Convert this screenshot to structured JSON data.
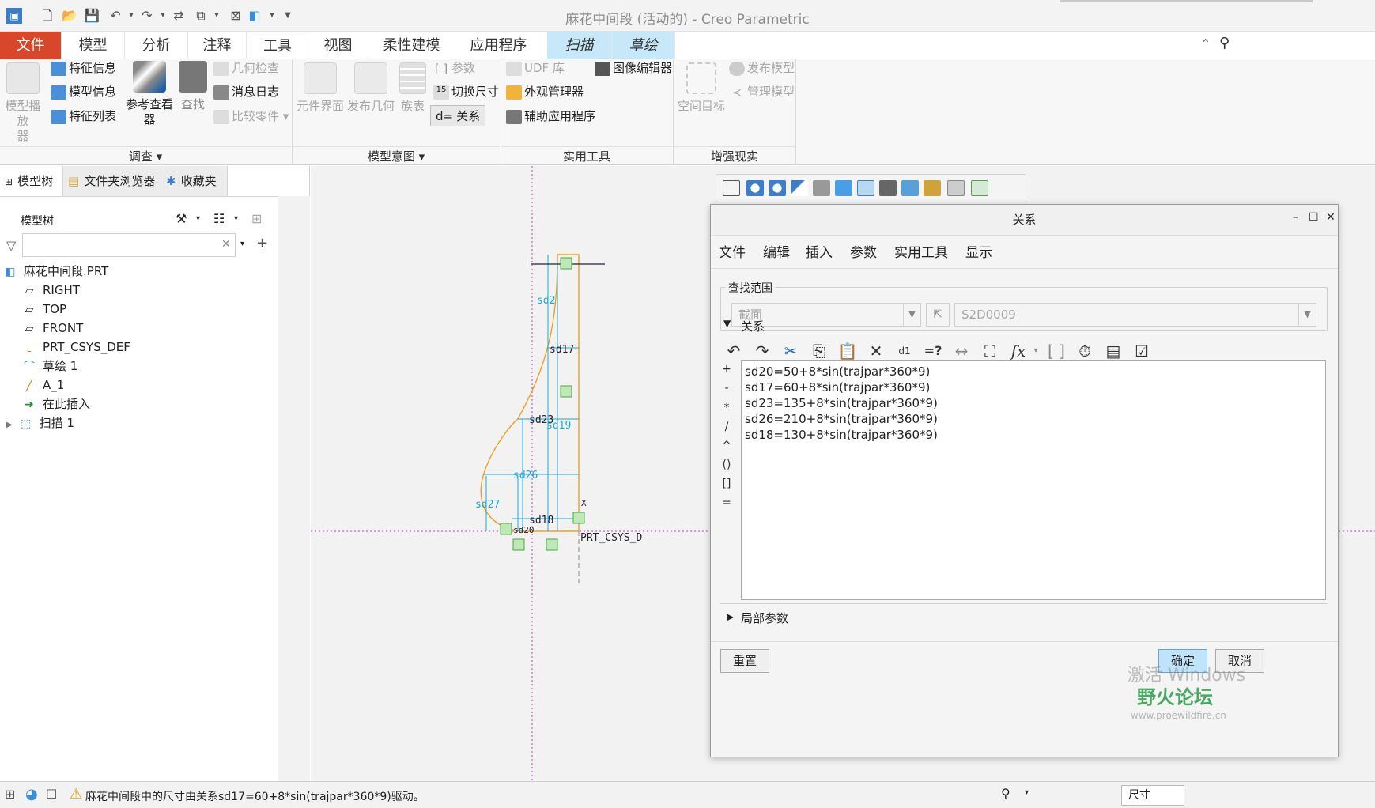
{
  "window": {
    "title": "麻花中间段 (活动的) - Creo Parametric"
  },
  "tabs": [
    {
      "label": "文件"
    },
    {
      "label": "模型"
    },
    {
      "label": "分析"
    },
    {
      "label": "注释"
    },
    {
      "label": "工具"
    },
    {
      "label": "视图"
    },
    {
      "label": "柔性建模"
    },
    {
      "label": "应用程序"
    },
    {
      "label": "扫描"
    },
    {
      "label": "草绘"
    }
  ],
  "ribbon": {
    "investigate": {
      "model_player": "模型播放\n器",
      "feature_info": "特征信息",
      "model_info": "模型信息",
      "feature_list": "特征列表",
      "ref_viewer": "参考查看\n器",
      "find": "查找",
      "geometry_check": "几何检查",
      "message_log": "消息日志",
      "compare_parts": "比较零件",
      "group_label": "调查"
    },
    "model_intent": {
      "component_interface": "元件界面",
      "publish_geometry": "发布几何",
      "family_table": "族表",
      "parameters": "参数",
      "switch_dims": "切换尺寸",
      "relations": "关系",
      "group_label": "模型意图"
    },
    "utilities": {
      "udf_library": "UDF 库",
      "image_editor": "图像编辑器",
      "appearance_manager": "外观管理器",
      "aux_apps": "辅助应用程序",
      "group_label": "实用工具"
    },
    "ar": {
      "space_target": "空间目标",
      "publish_model": "发布模型",
      "manage_model": "管理模型",
      "group_label": "增强现实"
    }
  },
  "left_panel": {
    "tabs": [
      "模型树",
      "文件夹浏览器",
      "收藏夹"
    ],
    "title": "模型树",
    "tree": [
      {
        "label": "麻花中间段.PRT",
        "icon": "part-icon"
      },
      {
        "label": "RIGHT",
        "icon": "datum-plane-icon"
      },
      {
        "label": "TOP",
        "icon": "datum-plane-icon"
      },
      {
        "label": "FRONT",
        "icon": "datum-plane-icon"
      },
      {
        "label": "PRT_CSYS_DEF",
        "icon": "csys-icon"
      },
      {
        "label": "草绘 1",
        "icon": "sketch-icon"
      },
      {
        "label": "A_1",
        "icon": "axis-icon"
      },
      {
        "label": "在此插入",
        "icon": "insert-here-icon"
      },
      {
        "label": "扫描 1",
        "icon": "sweep-icon"
      }
    ]
  },
  "sketch": {
    "dims": [
      "sd2",
      "sd17",
      "sd23",
      "sd19",
      "sd26",
      "sd27",
      "sd18",
      "sd20"
    ],
    "csys_label": "PRT_CSYS_D",
    "axis_x": "X"
  },
  "dialog": {
    "title": "关系",
    "menu": [
      "文件",
      "编辑",
      "插入",
      "参数",
      "实用工具",
      "显示"
    ],
    "scope_label": "查找范围",
    "scope_value": "截面",
    "scope_target": "S2D0009",
    "relations_label": "关系",
    "operators": [
      "+",
      "-",
      "*",
      "/",
      "^",
      "()",
      "[]",
      "="
    ],
    "lines": [
      "sd20=50+8*sin(trajpar*360*9)",
      "sd17=60+8*sin(trajpar*360*9)",
      "sd23=135+8*sin(trajpar*360*9)",
      "sd26=210+8*sin(trajpar*360*9)",
      "sd18=130+8*sin(trajpar*360*9)"
    ],
    "local_params_label": "局部参数",
    "reset_label": "重置",
    "ok_label": "确定",
    "cancel_label": "取消"
  },
  "status": {
    "message": "麻花中间段中的尺寸由关系sd17=60+8*sin(trajpar*360*9)驱动。",
    "filter_label": "尺寸"
  },
  "watermark": {
    "activate": "激活 Windows",
    "forum": "野火论坛",
    "url": "www.proewildfire.cn"
  },
  "colors": {
    "file_tab": "#d9472b",
    "ctx_tab": "#c7e8f8",
    "sketch_line": "#f0a020",
    "dim": "#1ea8d8",
    "ok_button": "#bfe3f9"
  }
}
